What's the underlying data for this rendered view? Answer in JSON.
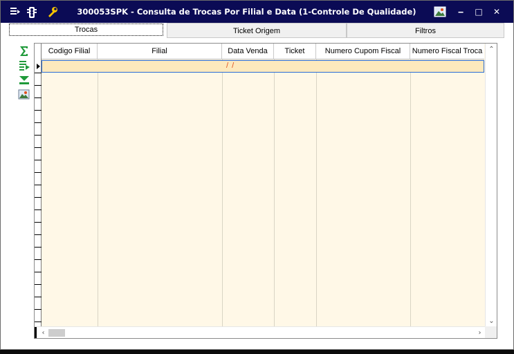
{
  "window": {
    "title": "300053SPK - Consulta de Trocas Por Filial e Data (1-Controle De Qualidade)",
    "controls": {
      "minimize": "‒",
      "maximize": "□",
      "close": "✕"
    },
    "icons": [
      "menu-icon",
      "traffic-light-icon",
      "wrench-icon",
      "picture-icon"
    ]
  },
  "tabs": [
    {
      "label": "Trocas",
      "active": true
    },
    {
      "label": "Ticket Origem",
      "active": false
    },
    {
      "label": "Filtros",
      "active": false
    }
  ],
  "side_tools": [
    "sum-icon",
    "export-icon",
    "filter-icon",
    "image-icon"
  ],
  "grid": {
    "columns": [
      "Codigo Filial",
      "Filial",
      "Data Venda",
      "Ticket",
      "Numero Cupom Fiscal",
      "Numero Fiscal Troca"
    ],
    "rows": [
      {
        "codigo_filial": "",
        "filial": "",
        "data_venda": "/ /",
        "ticket": "",
        "numero_cupom_fiscal": "",
        "numero_fiscal_troca": ""
      }
    ]
  },
  "colors": {
    "titlebar": "#0b0b55",
    "grid_background": "#fff8e7",
    "selected_row": "#fde9bd",
    "selected_row_border": "#2a6bd4",
    "date_text": "#e0501d"
  }
}
